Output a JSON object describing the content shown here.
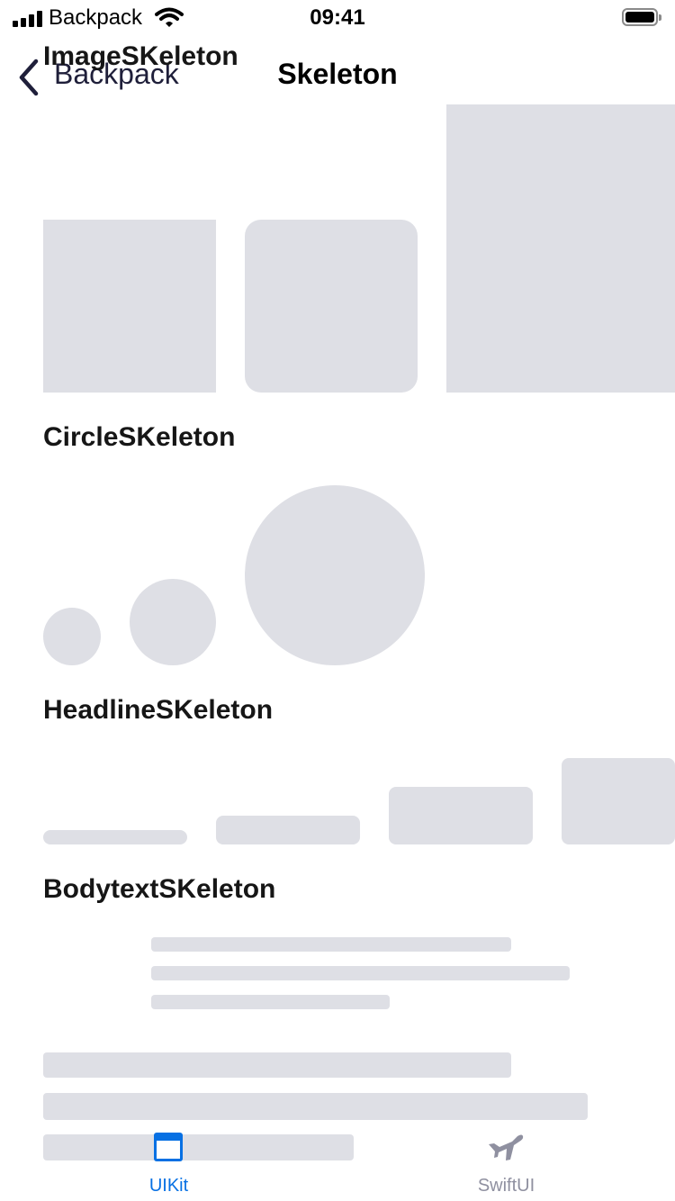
{
  "status_bar": {
    "carrier": "Backpack",
    "time": "09:41"
  },
  "navigation": {
    "back_label": "Backpack",
    "title": "Skeleton"
  },
  "sections": {
    "image": {
      "title": "ImageSKeleton"
    },
    "circle": {
      "title": "CircleSKeleton"
    },
    "headline": {
      "title": "HeadlineSKeleton"
    },
    "bodytext": {
      "title": "BodytextSKeleton"
    }
  },
  "tabs": [
    {
      "label": "UIKit",
      "icon": "window-icon",
      "selected": true
    },
    {
      "label": "SwiftUI",
      "icon": "airplane-icon",
      "selected": false
    }
  ],
  "colors": {
    "skeleton": "#dedfe5",
    "accent": "#0770e3",
    "inactive": "#8f90a0"
  }
}
